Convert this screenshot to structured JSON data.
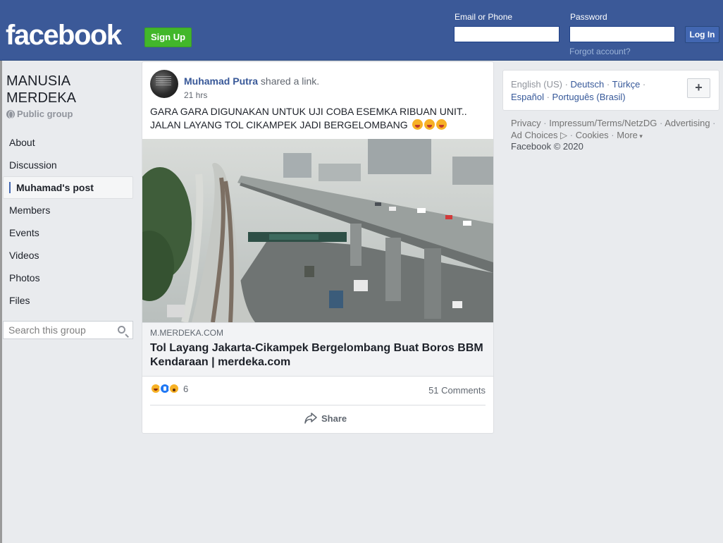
{
  "header": {
    "logo": "facebook",
    "signup_label": "Sign Up",
    "email_label": "Email or Phone",
    "password_label": "Password",
    "login_label": "Log In",
    "forgot_label": "Forgot account?",
    "brand_color": "#3b5998"
  },
  "group": {
    "title": "MANUSIA MERDEKA",
    "type": "Public group",
    "nav": [
      {
        "label": "About"
      },
      {
        "label": "Discussion"
      },
      {
        "label": "Muhamad's post"
      },
      {
        "label": "Members"
      },
      {
        "label": "Events"
      },
      {
        "label": "Videos"
      },
      {
        "label": "Photos"
      },
      {
        "label": "Files"
      }
    ],
    "search_placeholder": "Search this group"
  },
  "post": {
    "author": "Muhamad Putra",
    "action": " shared a link.",
    "time": "21 hrs",
    "text_line1": "GARA GARA DIGUNAKAN UNTUK UJI COBA ESEMKA RIBUAN UNIT..",
    "text_line2": "JALAN LAYANG TOL CIKAMPEK JADI BERGELOMBANG",
    "link_domain": "M.MERDEKA.COM",
    "link_title": "Tol Layang Jakarta-Cikampek Bergelombang Buat Boros BBM Kendaraan | merdeka.com",
    "reaction_count": "6",
    "comments_count": "51 Comments",
    "share_label": "Share"
  },
  "sidebar_right": {
    "current_language": "English (US)",
    "languages": [
      "Deutsch",
      "Türkçe",
      "Español",
      "Português (Brasil)"
    ],
    "footer_links": [
      "Privacy",
      "Impressum/Terms/NetzDG",
      "Advertising",
      "Ad Choices",
      "Cookies",
      "More"
    ],
    "copyright": "Facebook © 2020"
  }
}
